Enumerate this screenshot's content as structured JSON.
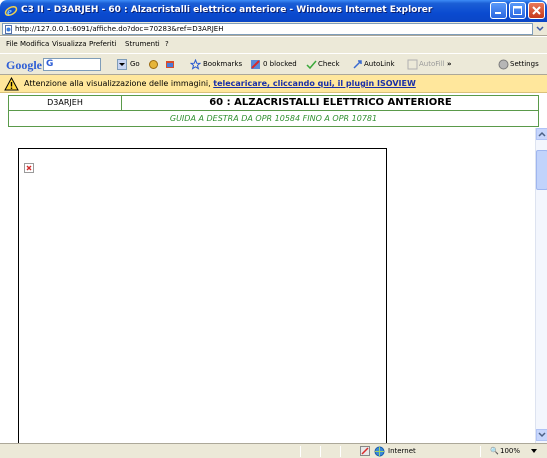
{
  "window": {
    "title": "C3 II - D3ARJEH - 60 : Alzacristalli elettrico anteriore - Windows Internet Explorer"
  },
  "address": {
    "url": "http://127.0.0.1:6091/affiche.do?doc=70283&ref=D3ARJEH"
  },
  "menu": {
    "items": [
      "File",
      "Modifica",
      "Visualizza",
      "Preferiti",
      "Strumenti",
      "?"
    ]
  },
  "toolbar": {
    "google": "Google",
    "g_suffix": "G",
    "go": "Go",
    "bookmarks": "Bookmarks",
    "blocked": "0 blocked",
    "check": "Check",
    "autolink": "AutoLink",
    "autofill": "AutoFill",
    "more": "»",
    "settings": "Settings"
  },
  "infobar": {
    "message": "Attenzione alla visualizzazione delle immagini,",
    "link": "telecaricare, cliccando qui, il plugin ISOVIEW"
  },
  "document": {
    "code": "D3ARJEH",
    "name": "60 : ALZACRISTALLI ELETTRICO ANTERIORE",
    "subtitle": "GUIDA A DESTRA DA OPR 10584 FINO A OPR 10781"
  },
  "status": {
    "zone": "Internet",
    "zoom": "100%"
  },
  "colors": {
    "titlebar": "#0a46c6",
    "infobar": "#ffe79c",
    "border_green": "#5a9a4a",
    "subtitle_green": "#2f8f2f",
    "link_blue": "#1a2fa8"
  },
  "icons": [
    "ie-icon",
    "minimize-icon",
    "maximize-icon",
    "close-icon",
    "page-icon",
    "warning-icon",
    "broken-image-icon",
    "globe-icon",
    "popup-blocked-icon"
  ]
}
